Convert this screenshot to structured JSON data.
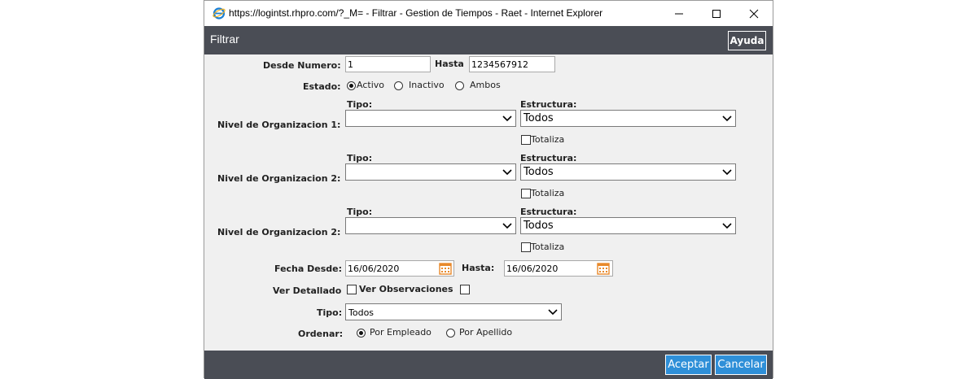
{
  "window": {
    "title": "https://logintst.rhpro.com/?_M= - Filtrar - Gestion de Tiempos - Raet - Internet Explorer"
  },
  "header": {
    "title": "Filtrar",
    "help_label": "Ayuda"
  },
  "form": {
    "desde_numero_label": "Desde Numero:",
    "desde_numero_value": "1",
    "hasta_label": "Hasta",
    "hasta_value": "1234567912",
    "estado_label": "Estado:",
    "estado_options": [
      "Activo",
      "Inactivo",
      "Ambos"
    ],
    "estado_selected": "Activo",
    "niveles": [
      {
        "label": "Nivel de Organizacion 1:",
        "tipo_label": "Tipo:",
        "tipo_value": "",
        "estructura_label": "Estructura:",
        "estructura_value": "Todos",
        "totaliza_label": "Totaliza",
        "totaliza_checked": false
      },
      {
        "label": "Nivel de Organizacion 2:",
        "tipo_label": "Tipo:",
        "tipo_value": "",
        "estructura_label": "Estructura:",
        "estructura_value": "Todos",
        "totaliza_label": "Totaliza",
        "totaliza_checked": false
      },
      {
        "label": "Nivel de Organizacion 2:",
        "tipo_label": "Tipo:",
        "tipo_value": "",
        "estructura_label": "Estructura:",
        "estructura_value": "Todos",
        "totaliza_label": "Totaliza",
        "totaliza_checked": false
      }
    ],
    "fecha_desde_label": "Fecha Desde:",
    "fecha_desde_value": "16/06/2020",
    "fecha_hasta_label": "Hasta:",
    "fecha_hasta_value": "16/06/2020",
    "ver_detallado_label": "Ver Detallado",
    "ver_observaciones_label": "Ver Observaciones",
    "tipo_label": "Tipo:",
    "tipo_value": "Todos",
    "ordenar_label": "Ordenar:",
    "ordenar_options": [
      "Por Empleado",
      "Por Apellido"
    ],
    "ordenar_selected": "Por Empleado"
  },
  "footer": {
    "accept_label": "Aceptar",
    "cancel_label": "Cancelar"
  },
  "colors": {
    "header_bg": "#4a4d55",
    "button_blue": "#2e8fd8",
    "calendar_orange": "#e8892b"
  }
}
